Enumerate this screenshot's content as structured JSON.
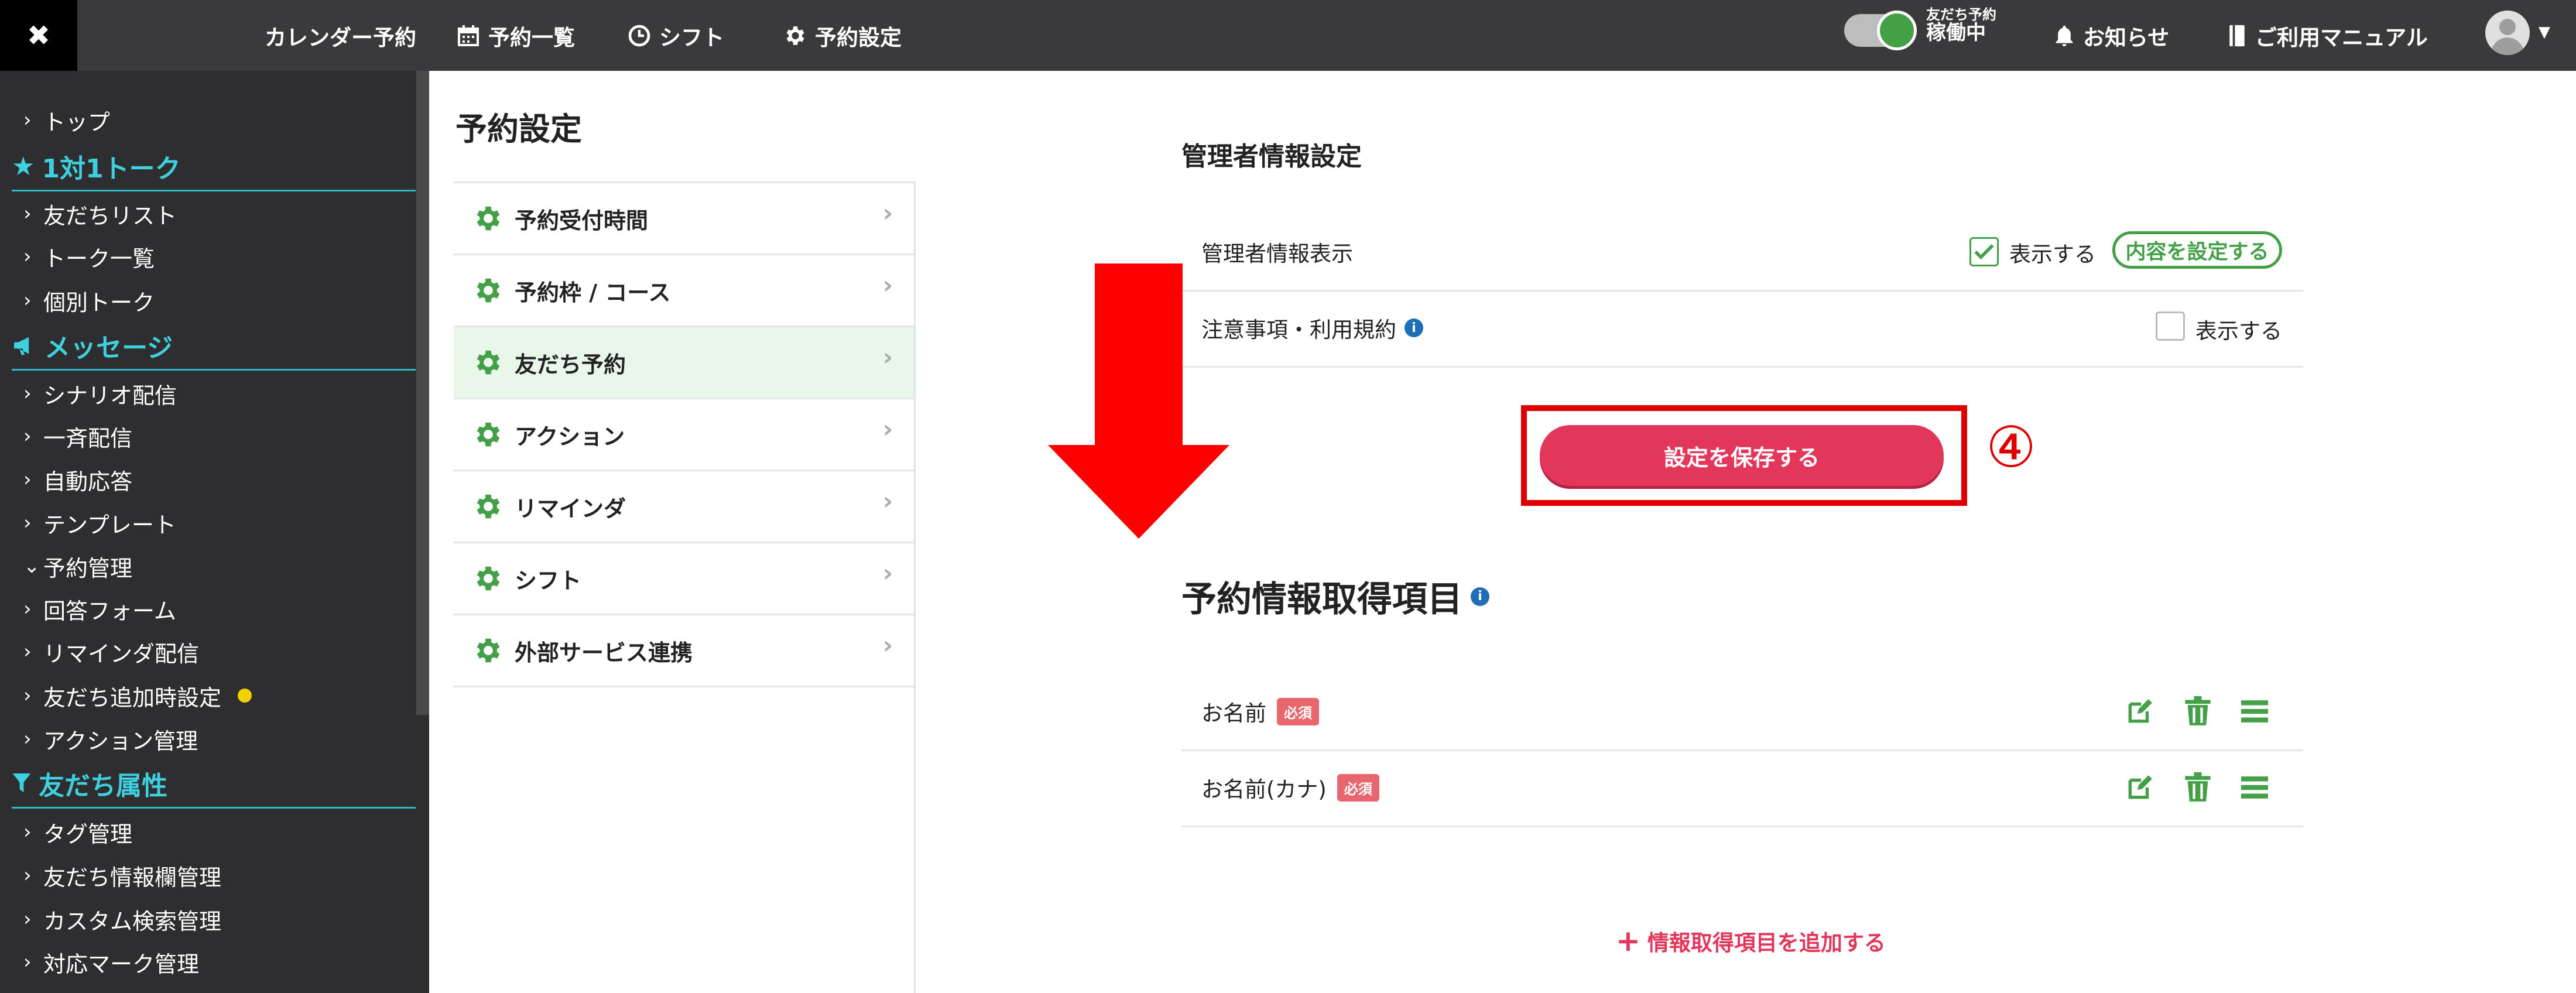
{
  "topbar": {
    "close_glyph": "✖",
    "nav": [
      {
        "label": "カレンダー予約",
        "icon": ""
      },
      {
        "label": "予約一覧",
        "icon": "calendar-icon"
      },
      {
        "label": "シフト",
        "icon": "clock-icon"
      },
      {
        "label": "予約設定",
        "icon": "gear-icon"
      }
    ],
    "toggle_label_small": "友だち予約",
    "toggle_label": "稼働中",
    "notice": "お知らせ",
    "manual": "ご利用マニュアル"
  },
  "sidebar": {
    "items": {
      "top": "トップ",
      "h_talk": "1対1トーク",
      "friend_list": "友だちリスト",
      "talk_list": "トーク一覧",
      "indiv_talk": "個別トーク",
      "h_message": "メッセージ",
      "scenario": "シナリオ配信",
      "broadcast": "一斉配信",
      "auto_reply": "自動応答",
      "template": "テンプレート",
      "reserve_mgmt": "予約管理",
      "answer_form": "回答フォーム",
      "remind": "リマインダ配信",
      "friend_add": "友だち追加時設定",
      "action_mgmt": "アクション管理",
      "h_attr": "友だち属性",
      "tag_mgmt": "タグ管理",
      "friend_info": "友だち情報欄管理",
      "custom_search": "カスタム検索管理",
      "mark_mgmt": "対応マーク管理"
    }
  },
  "settings": {
    "title": "予約設定",
    "menu": [
      "予約受付時間",
      "予約枠 / コース",
      "友だち予約",
      "アクション",
      "リマインダ",
      "シフト",
      "外部サービス連携"
    ],
    "active_index": 2
  },
  "admin": {
    "heading": "管理者情報設定",
    "row1_label": "管理者情報表示",
    "row1_check": "表示する",
    "row1_button": "内容を設定する",
    "row2_label": "注意事項・利用規約",
    "row2_check": "表示する",
    "save_button": "設定を保存する",
    "step": "④"
  },
  "booking": {
    "heading": "予約情報取得項目",
    "required_badge": "必須",
    "items": [
      "お名前",
      "お名前(カナ)"
    ],
    "add_link": "情報取得項目を追加する"
  },
  "colors": {
    "accent_green": "#43a047",
    "accent_pink": "#e2365a",
    "highlight_red": "#e00000",
    "sidebar_head": "#3fd0e0"
  }
}
